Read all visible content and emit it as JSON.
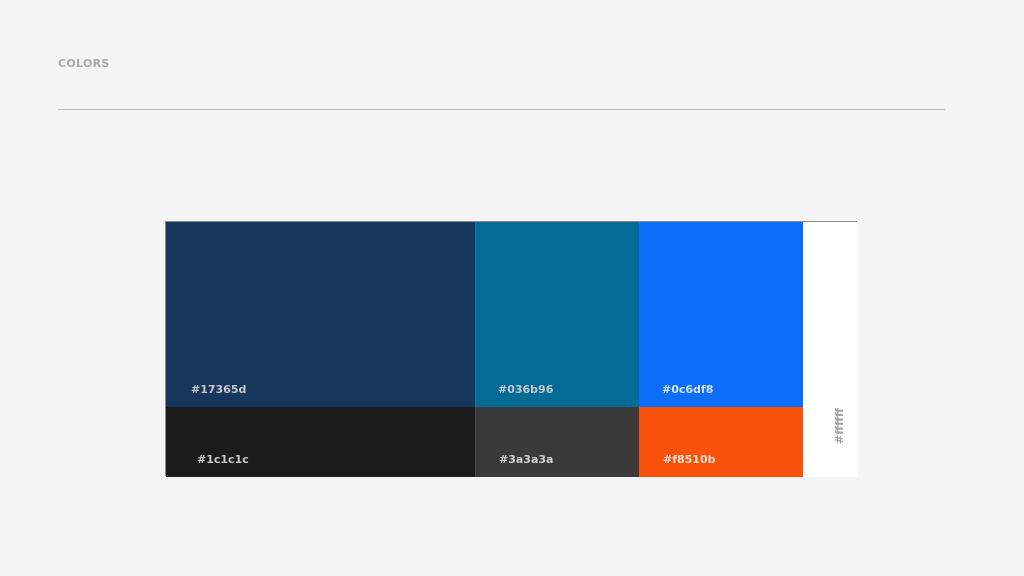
{
  "page": {
    "title": "COLORS"
  },
  "swatches": [
    {
      "hex": "#17365d",
      "label": "#17365d"
    },
    {
      "hex": "#036b96",
      "label": "#036b96"
    },
    {
      "hex": "#0c6df8",
      "label": "#0c6df8"
    },
    {
      "hex": "#1c1c1c",
      "label": "#1c1c1c"
    },
    {
      "hex": "#3a3a3a",
      "label": "#3a3a3a"
    },
    {
      "hex": "#f8510b",
      "label": "#f8510b"
    },
    {
      "hex": "#ffffff",
      "label": "#ffffff"
    }
  ]
}
